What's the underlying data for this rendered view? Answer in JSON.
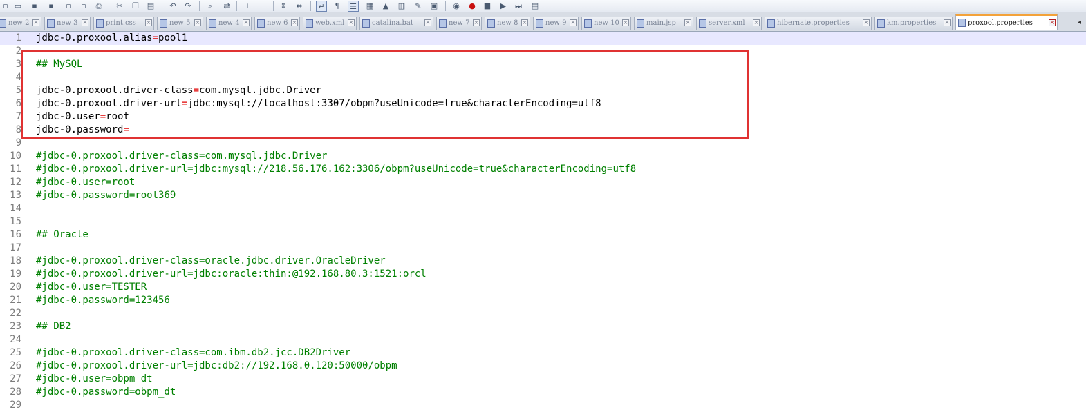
{
  "toolbar": {
    "buttons": [
      {
        "name": "new-file-icon",
        "glyph": "▫"
      },
      {
        "name": "open-file-icon",
        "glyph": "▭"
      },
      {
        "name": "save-icon",
        "glyph": "▪"
      },
      {
        "name": "save-all-icon",
        "glyph": "▪"
      },
      {
        "name": "close-icon",
        "glyph": "▫"
      },
      {
        "name": "close-all-icon",
        "glyph": "▫"
      },
      {
        "name": "print-icon",
        "glyph": "⎙"
      },
      {
        "name": "cut-icon",
        "glyph": "✂"
      },
      {
        "name": "copy-icon",
        "glyph": "❐"
      },
      {
        "name": "paste-icon",
        "glyph": "▤"
      },
      {
        "name": "undo-icon",
        "glyph": "↶"
      },
      {
        "name": "redo-icon",
        "glyph": "↷"
      },
      {
        "name": "find-icon",
        "glyph": "⌕"
      },
      {
        "name": "replace-icon",
        "glyph": "⇄"
      },
      {
        "name": "zoom-in-icon",
        "glyph": "+"
      },
      {
        "name": "zoom-out-icon",
        "glyph": "−"
      },
      {
        "name": "sync-vertical-icon",
        "glyph": "⇕"
      },
      {
        "name": "sync-horizontal-icon",
        "glyph": "⇔"
      },
      {
        "name": "word-wrap-icon",
        "glyph": "↵"
      },
      {
        "name": "show-all-chars-icon",
        "glyph": "¶"
      },
      {
        "name": "indent-guide-icon",
        "glyph": "☰"
      },
      {
        "name": "user-lang-icon",
        "glyph": "▦"
      },
      {
        "name": "function-list-icon",
        "glyph": "▲"
      },
      {
        "name": "folder-workspace-icon",
        "glyph": "▥"
      },
      {
        "name": "doc-map-icon",
        "glyph": "✎"
      },
      {
        "name": "monitor-icon",
        "glyph": "▣"
      },
      {
        "name": "eye-icon",
        "glyph": "◉"
      },
      {
        "name": "record-macro-icon",
        "glyph": "●"
      },
      {
        "name": "stop-macro-icon",
        "glyph": "■"
      },
      {
        "name": "play-macro-icon",
        "glyph": "▶"
      },
      {
        "name": "run-macro-multiple-icon",
        "glyph": "⏭"
      },
      {
        "name": "save-macro-icon",
        "glyph": "▤"
      }
    ]
  },
  "tabs": [
    {
      "label": "new 2",
      "active": false
    },
    {
      "label": "new 3",
      "active": false
    },
    {
      "label": "print.css",
      "active": false
    },
    {
      "label": "new 5",
      "active": false
    },
    {
      "label": "new 4",
      "active": false
    },
    {
      "label": "new 6",
      "active": false
    },
    {
      "label": "web.xml",
      "active": false
    },
    {
      "label": "catalina.bat",
      "active": false
    },
    {
      "label": "new 7",
      "active": false
    },
    {
      "label": "new 8",
      "active": false
    },
    {
      "label": "new 9",
      "active": false
    },
    {
      "label": "new 10",
      "active": false
    },
    {
      "label": "main.jsp",
      "active": false
    },
    {
      "label": "server.xml",
      "active": false
    },
    {
      "label": "hibernate.properties",
      "active": false
    },
    {
      "label": "km.properties",
      "active": false
    },
    {
      "label": "proxool.properties",
      "active": true
    }
  ],
  "tab_close_glyph": "×",
  "tab_scroll_glyph": "◂",
  "editor": {
    "current_line": 1,
    "lines": [
      {
        "n": "1",
        "text": "jdbc-0.proxool.alias=pool1",
        "kind": "kv"
      },
      {
        "n": "2",
        "text": "",
        "kind": "blank"
      },
      {
        "n": "3",
        "text": "## MySQL",
        "kind": "comment"
      },
      {
        "n": "4",
        "text": "",
        "kind": "blank"
      },
      {
        "n": "5",
        "text": "jdbc-0.proxool.driver-class=com.mysql.jdbc.Driver",
        "kind": "kv"
      },
      {
        "n": "6",
        "text": "jdbc-0.proxool.driver-url=jdbc:mysql://localhost:3307/obpm?useUnicode=true&characterEncoding=utf8",
        "kind": "kv"
      },
      {
        "n": "7",
        "text": "jdbc-0.user=root",
        "kind": "kv"
      },
      {
        "n": "8",
        "text": "jdbc-0.password=",
        "kind": "kv"
      },
      {
        "n": "9",
        "text": "",
        "kind": "blank"
      },
      {
        "n": "10",
        "text": "#jdbc-0.proxool.driver-class=com.mysql.jdbc.Driver",
        "kind": "comment"
      },
      {
        "n": "11",
        "text": "#jdbc-0.proxool.driver-url=jdbc:mysql://218.56.176.162:3306/obpm?useUnicode=true&characterEncoding=utf8",
        "kind": "comment"
      },
      {
        "n": "12",
        "text": "#jdbc-0.user=root",
        "kind": "comment"
      },
      {
        "n": "13",
        "text": "#jdbc-0.password=root369",
        "kind": "comment"
      },
      {
        "n": "14",
        "text": "",
        "kind": "blank"
      },
      {
        "n": "15",
        "text": "",
        "kind": "blank"
      },
      {
        "n": "16",
        "text": "## Oracle",
        "kind": "comment"
      },
      {
        "n": "17",
        "text": "",
        "kind": "blank"
      },
      {
        "n": "18",
        "text": "#jdbc-0.proxool.driver-class=oracle.jdbc.driver.OracleDriver",
        "kind": "comment"
      },
      {
        "n": "19",
        "text": "#jdbc-0.proxool.driver-url=jdbc:oracle:thin:@192.168.80.3:1521:orcl",
        "kind": "comment"
      },
      {
        "n": "20",
        "text": "#jdbc-0.user=TESTER",
        "kind": "comment"
      },
      {
        "n": "21",
        "text": "#jdbc-0.password=123456",
        "kind": "comment"
      },
      {
        "n": "22",
        "text": "",
        "kind": "blank"
      },
      {
        "n": "23",
        "text": "## DB2",
        "kind": "comment"
      },
      {
        "n": "24",
        "text": "",
        "kind": "blank"
      },
      {
        "n": "25",
        "text": "#jdbc-0.proxool.driver-class=com.ibm.db2.jcc.DB2Driver",
        "kind": "comment"
      },
      {
        "n": "26",
        "text": "#jdbc-0.proxool.driver-url=jdbc:db2://192.168.0.120:50000/obpm",
        "kind": "comment"
      },
      {
        "n": "27",
        "text": "#jdbc-0.user=obpm_dt",
        "kind": "comment"
      },
      {
        "n": "28",
        "text": "#jdbc-0.password=obpm_dt",
        "kind": "comment"
      },
      {
        "n": "29",
        "text": "",
        "kind": "blank"
      }
    ]
  },
  "colors": {
    "comment": "#008000",
    "operator": "#e00000",
    "current_line": "#e8e8ff",
    "annotation_box": "#e03232",
    "active_tab_accent": "#f3a23a"
  }
}
